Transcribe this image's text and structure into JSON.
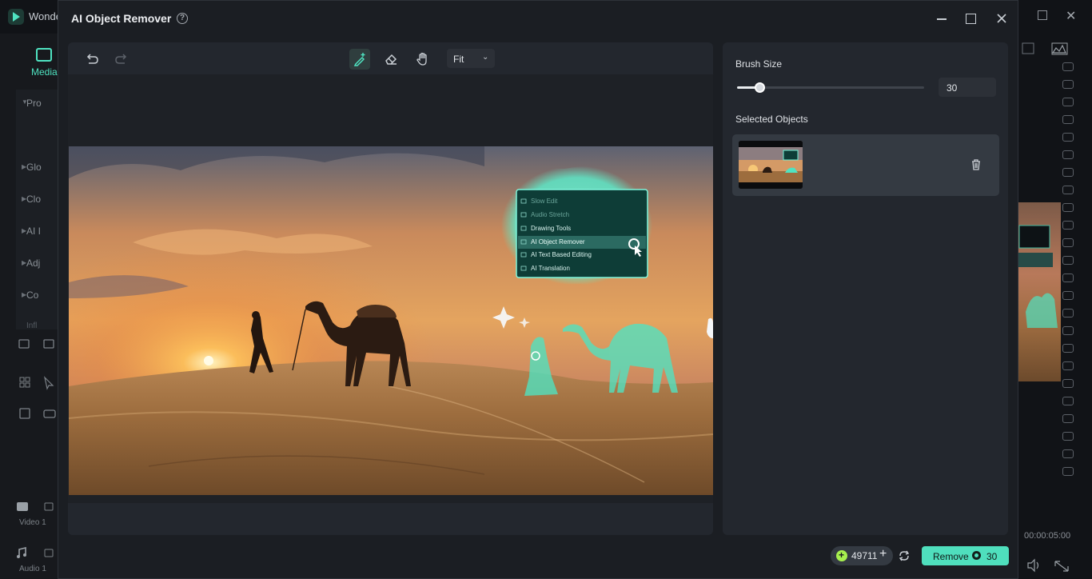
{
  "background_app": {
    "title": "Wondershare Filmora",
    "media_tab": "Media",
    "tree_items": [
      "Pro",
      "Glo",
      "Clo",
      "AI I",
      "Adj",
      "Co",
      "Infl"
    ],
    "tracks": [
      "Video 1",
      "Audio 1"
    ],
    "timecode": "00:00:05:00"
  },
  "dialog": {
    "title": "AI Object Remover",
    "zoom": "Fit",
    "brush_size_label": "Brush Size",
    "brush_size": 30,
    "brush_size_value": "30",
    "brush_size_fraction": 0.12,
    "selected_objects_label": "Selected Objects",
    "credits": "49711",
    "remove_label": "Remove",
    "remove_cost": "30"
  },
  "image_overlay_menu": [
    "Slow Edit",
    "Audio Stretch",
    "Drawing Tools",
    "AI Object Remover",
    "AI Text Based Editing",
    "AI Translation"
  ],
  "colors": {
    "accent": "#4fdfbd",
    "mask": "#4fe3c1",
    "dialog_bg": "#1b1e23",
    "panel_bg": "#23272e"
  },
  "icons": [
    "undo-icon",
    "redo-icon",
    "smart-brush-icon",
    "eraser-icon",
    "hand-icon",
    "help-icon",
    "trash-icon",
    "refresh-icon",
    "credit-coin-icon"
  ]
}
